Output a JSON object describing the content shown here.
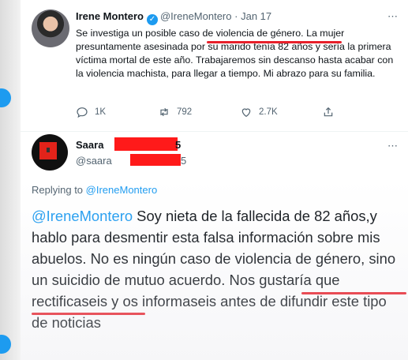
{
  "tweet": {
    "author_name": "Irene Montero",
    "author_handle": "@IreneMontero",
    "dot": "·",
    "date": "Jan 17",
    "text": "Se investiga un posible caso de violencia de género. La mujer presuntamente asesinada por su marido tenía 82 años y sería la primera víctima mortal de este año. Trabajaremos sin descanso hasta acabar con la violencia machista, para llegar a tiempo. Mi abrazo para su familia.",
    "replies": "1K",
    "retweets": "792",
    "likes": "2.7K",
    "more_label": "⋯"
  },
  "reply": {
    "author_name": "Saara",
    "name_suffix": "5",
    "author_handle": "@saara",
    "handle_suffix": "5",
    "more_label": "⋯",
    "replying_prefix": "Replying to ",
    "replying_to": "@IreneMontero",
    "mention": "@IreneMontero",
    "text": " Soy nieta de la fallecida de 82 años,y hablo para desmentir esta falsa información sobre mis abuelos. No es ningún caso de violencia de género, sino un suicidio de mutuo acuerdo. Nos gustaría que rectificaseis y os informaseis antes de difundir este tipo de noticias"
  },
  "colors": {
    "accent": "#1d9bf0",
    "highlight_underline": "#e8202a",
    "redaction": "#ff1a1a"
  },
  "icons": [
    "verified-badge-icon",
    "reply-icon",
    "retweet-icon",
    "like-icon",
    "share-icon",
    "more-icon"
  ]
}
